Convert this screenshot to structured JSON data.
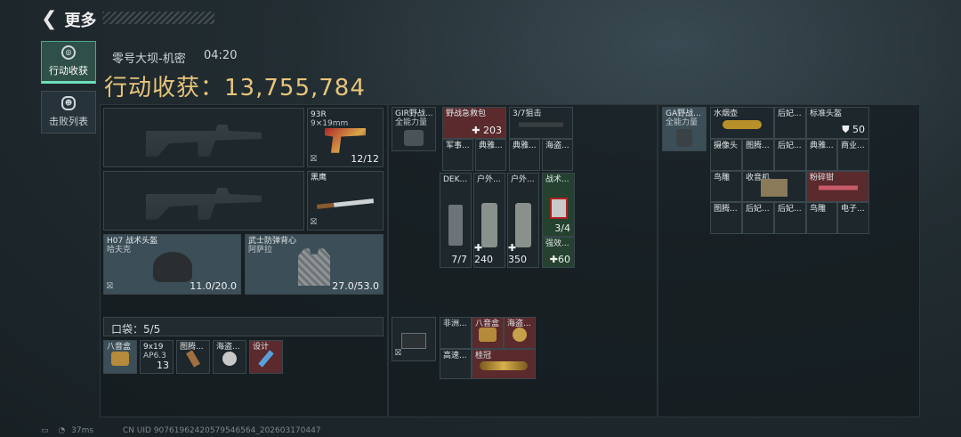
{
  "header": {
    "title": "更多",
    "back_icon": "back-arrow-icon"
  },
  "tabs": [
    {
      "label": "行动收获",
      "icon": "coin-icon",
      "active": true
    },
    {
      "label": "击败列表",
      "icon": "skull-icon",
      "active": false
    }
  ],
  "summary": {
    "map": "零号大坝-机密",
    "time": "04:20",
    "income_label": "行动收获：",
    "income_value": "13,755,784"
  },
  "gear": {
    "pistol": {
      "name": "93R",
      "sub": "9×19mm",
      "durability": "12/12"
    },
    "melee": {
      "name": "黑鹰"
    },
    "helmet": {
      "name": "H07 战术头盔",
      "sub": "哈夫克",
      "durability": "11.0/20.0"
    },
    "armor": {
      "name": "武士防弹背心",
      "sub": "阿萨拉",
      "durability": "27.0/53.0"
    }
  },
  "pocket": {
    "label": "口袋：5/5",
    "items": [
      {
        "name": "八音盒"
      },
      {
        "name": "9x19",
        "sub": "AP6.3",
        "count": "13"
      },
      {
        "name": "图腾..."
      },
      {
        "name": "海盗..."
      },
      {
        "name": "设计"
      }
    ]
  },
  "backpack1": {
    "name": "GIR野战...",
    "sub": "全能力量"
  },
  "chest_items": [
    {
      "name": "野战急救包",
      "value": "203"
    },
    {
      "name": "3/7狙击"
    },
    {
      "name": "军事..."
    },
    {
      "name": "典雅..."
    },
    {
      "name": "典雅..."
    },
    {
      "name": "海盗..."
    }
  ],
  "rig_items": [
    {
      "name": "DEK...",
      "value": "7/7"
    },
    {
      "name": "户外...",
      "value": "240"
    },
    {
      "name": "户外...",
      "value": "350"
    },
    {
      "name": "战术...",
      "value": "3/4"
    },
    {
      "name": "强效...",
      "value": "60"
    }
  ],
  "case1": {
    "name": "case"
  },
  "case_items": [
    {
      "name": "非洲..."
    },
    {
      "name": "八音盒"
    },
    {
      "name": "海盗..."
    },
    {
      "name": "高速..."
    },
    {
      "name": "桂冠"
    }
  ],
  "backpack2": {
    "name": "GA野战...",
    "sub": "全能力量"
  },
  "bag_items": [
    {
      "name": "水烟壶"
    },
    {
      "name": "后妃..."
    },
    {
      "name": "标准头盔",
      "value": "50"
    },
    {
      "name": "摄像头"
    },
    {
      "name": "图腾..."
    },
    {
      "name": "后妃..."
    },
    {
      "name": "典雅..."
    },
    {
      "name": "商业..."
    },
    {
      "name": "鸟雕"
    },
    {
      "name": "收音机"
    },
    {
      "name": "粉碎钳"
    },
    {
      "name": "图腾..."
    },
    {
      "name": "后妃..."
    },
    {
      "name": "后妃..."
    },
    {
      "name": "鸟雕"
    },
    {
      "name": "电子..."
    }
  ],
  "footer": {
    "ping": "37ms",
    "uid": "CN UID 9076196242057954656​4_202603170447"
  }
}
